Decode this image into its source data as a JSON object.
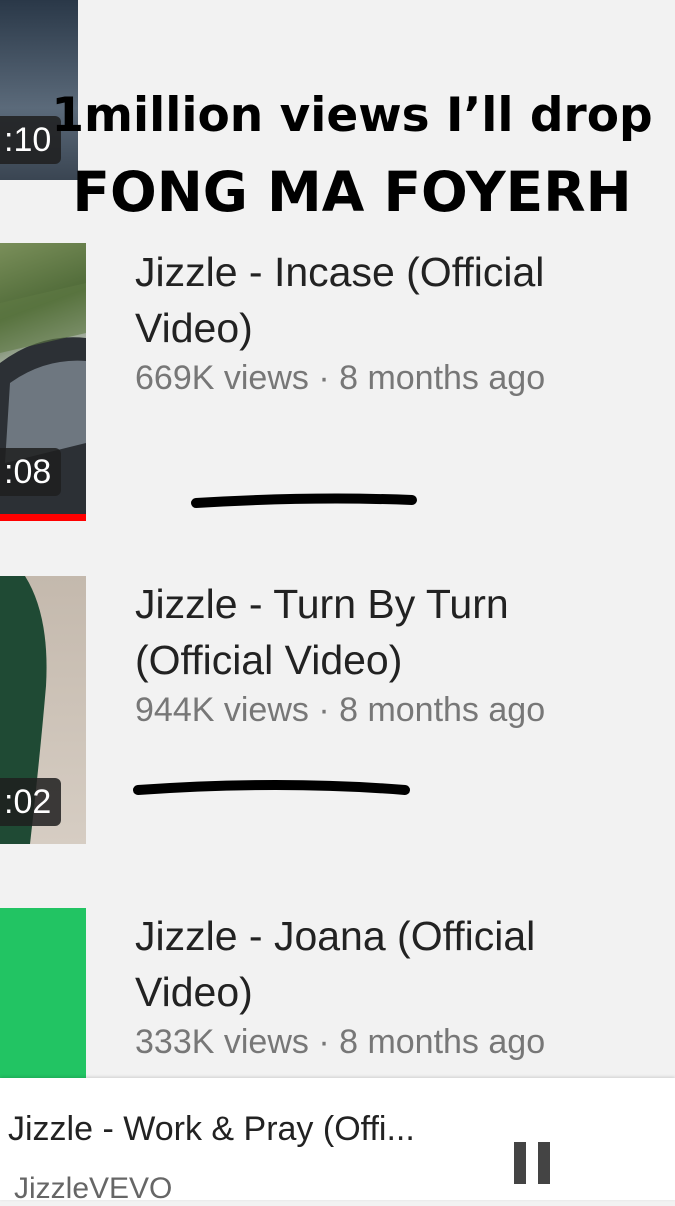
{
  "overlay": {
    "line1": "1million views I’ll drop",
    "line2": "FONG MA FOYERH"
  },
  "videos": [
    {
      "duration": ":10"
    },
    {
      "title": "Jizzle - Incase (Official Video)",
      "title_line1": "Jizzle - Incase (Official",
      "title_line2": "Video)",
      "meta": "669K views · 8 months ago",
      "duration": ":08"
    },
    {
      "title": "Jizzle - Turn By Turn (Official Video)",
      "title_line1": "Jizzle - Turn By Turn",
      "title_line2": "(Official Video)",
      "meta": "944K views · 8 months ago",
      "duration": ":02"
    },
    {
      "title": "Jizzle - Joana (Official Video)",
      "title_line1": "Jizzle - Joana (Official",
      "title_line2": "Video)",
      "meta": "333K views · 8 months ago"
    }
  ],
  "miniplayer": {
    "title": "Jizzle - Work & Pray (Offi...",
    "channel": "JizzleVEVO",
    "pause_icon": "pause-icon"
  },
  "colors": {
    "progress_red": "#ff0000",
    "thumb_green": "#22c463"
  }
}
